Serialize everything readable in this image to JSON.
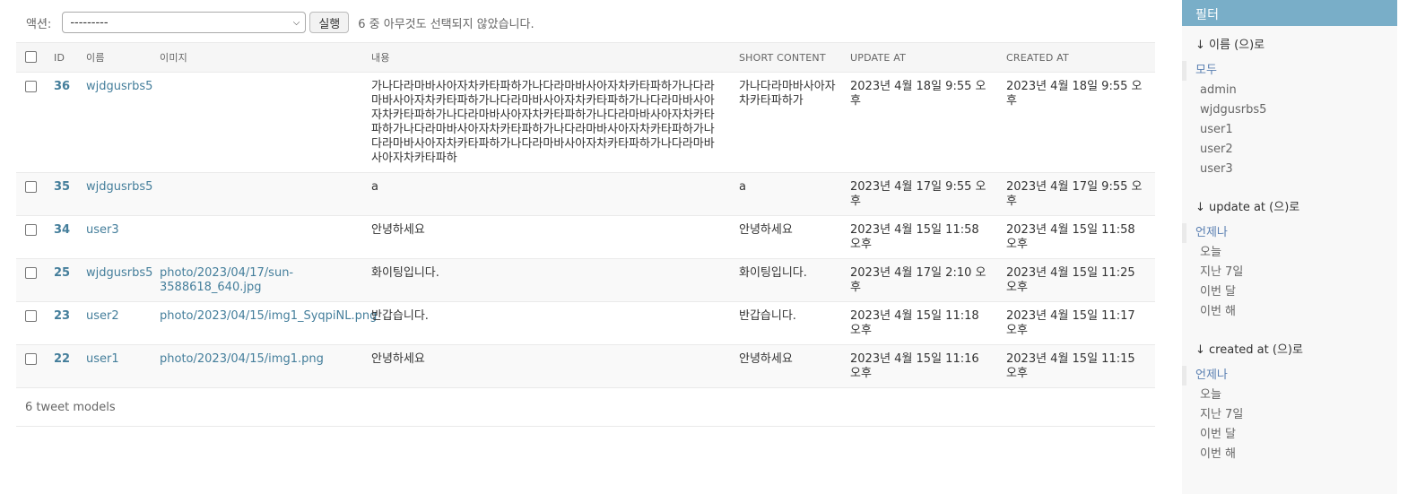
{
  "actions": {
    "label": "액션:",
    "select_value": "---------",
    "go_button": "실행",
    "counter": "6 중 아무것도 선택되지 않았습니다."
  },
  "table": {
    "headers": [
      "ID",
      "이름",
      "이미지",
      "내용",
      "SHORT CONTENT",
      "UPDATE AT",
      "CREATED AT"
    ],
    "rows": [
      {
        "id": "36",
        "name": "wjdgusrbs5",
        "image": "",
        "content": "가나다라마바사아자차카타파하가나다라마바사아자차카타파하가나다라마바사아자차카타파하가나다라마바사아자차카타파하가나다라마바사아자차카타파하가나다라마바사아자차카타파하가나다라마바사아자차카타파하가나다라마바사아자차카타파하가나다라마바사아자차카타파하가나다라마바사아자차카타파하가나다라마바사아자차카타파하가나다라마바사아자차카타파하",
        "short": "가나다라마바사아자차카타파하가",
        "update_at": "2023년 4월 18일 9:55 오후",
        "created_at": "2023년 4월 18일 9:55 오후"
      },
      {
        "id": "35",
        "name": "wjdgusrbs5",
        "image": "",
        "content": "a",
        "short": "a",
        "update_at": "2023년 4월 17일 9:55 오후",
        "created_at": "2023년 4월 17일 9:55 오후"
      },
      {
        "id": "34",
        "name": "user3",
        "image": "",
        "content": "안녕하세요",
        "short": "안녕하세요",
        "update_at": "2023년 4월 15일 11:58 오후",
        "created_at": "2023년 4월 15일 11:58 오후"
      },
      {
        "id": "25",
        "name": "wjdgusrbs5",
        "image": "photo/2023/04/17/sun-3588618_640.jpg",
        "content": "화이팅입니다.",
        "short": "화이팅입니다.",
        "update_at": "2023년 4월 17일 2:10 오후",
        "created_at": "2023년 4월 15일 11:25 오후"
      },
      {
        "id": "23",
        "name": "user2",
        "image": "photo/2023/04/15/img1_SyqpiNL.png",
        "content": "반갑습니다.",
        "short": "반갑습니다.",
        "update_at": "2023년 4월 15일 11:18 오후",
        "created_at": "2023년 4월 15일 11:17 오후"
      },
      {
        "id": "22",
        "name": "user1",
        "image": "photo/2023/04/15/img1.png",
        "content": "안녕하세요",
        "short": "안녕하세요",
        "update_at": "2023년 4월 15일 11:16 오후",
        "created_at": "2023년 4월 15일 11:15 오후"
      }
    ],
    "paginator": "6 tweet models"
  },
  "filter": {
    "title": "필터",
    "groups": [
      {
        "heading": "↓ 이름 (으)로",
        "items": [
          "모두",
          "admin",
          "wjdgusrbs5",
          "user1",
          "user2",
          "user3"
        ],
        "selected": 0
      },
      {
        "heading": "↓ update at (으)로",
        "items": [
          "언제나",
          "오늘",
          "지난 7일",
          "이번 달",
          "이번 해"
        ],
        "selected": 0
      },
      {
        "heading": "↓ created at (으)로",
        "items": [
          "언제나",
          "오늘",
          "지난 7일",
          "이번 달",
          "이번 해"
        ],
        "selected": 0
      }
    ]
  },
  "colors": {
    "link": "#447e9b",
    "filter_header": "#79aec8",
    "selected_filter": "#5b80b2"
  }
}
